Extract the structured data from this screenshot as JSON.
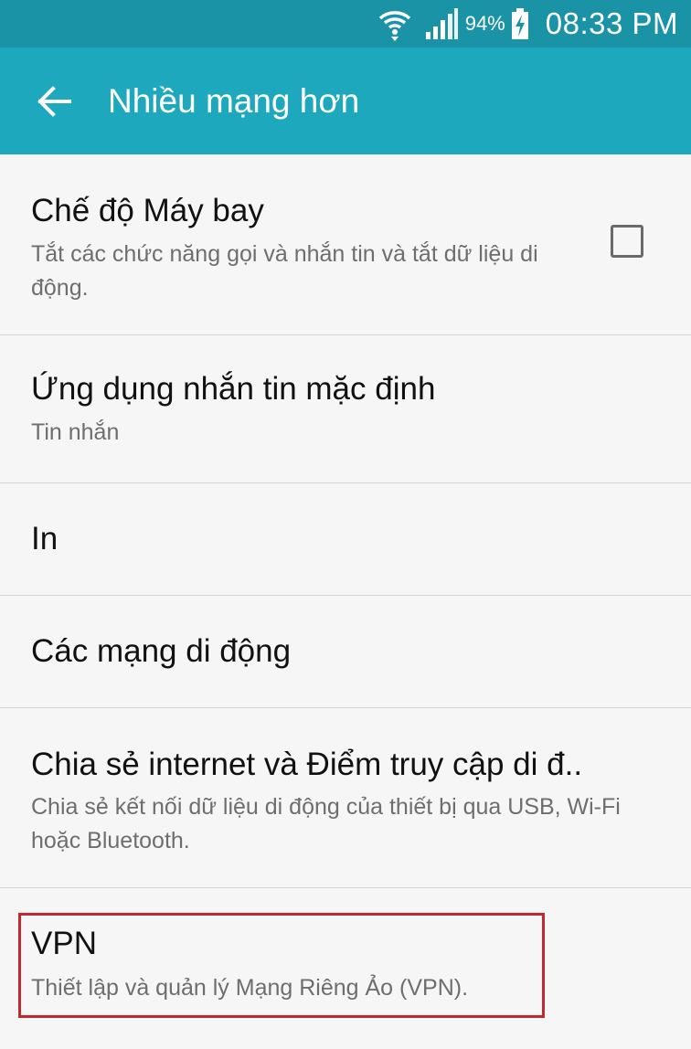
{
  "status_bar": {
    "battery_percent": "94%",
    "time": "08:33 PM",
    "icons": [
      "wifi-icon",
      "signal-icon",
      "battery-charging-icon"
    ]
  },
  "header": {
    "title": "Nhiều mạng hơn",
    "back_icon": "arrow-left-icon"
  },
  "items": [
    {
      "label": "Chế độ Máy bay",
      "sub": "Tắt các chức năng gọi và nhắn tin và tắt dữ liệu di động.",
      "checked": false
    },
    {
      "label": "Ứng dụng nhắn tin mặc định",
      "sub": "Tin nhắn"
    },
    {
      "label": "In"
    },
    {
      "label": "Các mạng di động"
    },
    {
      "label": "Chia sẻ internet và Điểm truy cập di đ..",
      "sub": "Chia sẻ kết nối dữ liệu di động của thiết bị qua USB, Wi-Fi hoặc Bluetooth."
    },
    {
      "label": "VPN",
      "sub": "Thiết lập và quản lý Mạng Riêng Ảo (VPN)."
    }
  ],
  "colors": {
    "status_bar": "#1b93a6",
    "app_bar": "#1ea8bd",
    "highlight": "#c3272f"
  }
}
